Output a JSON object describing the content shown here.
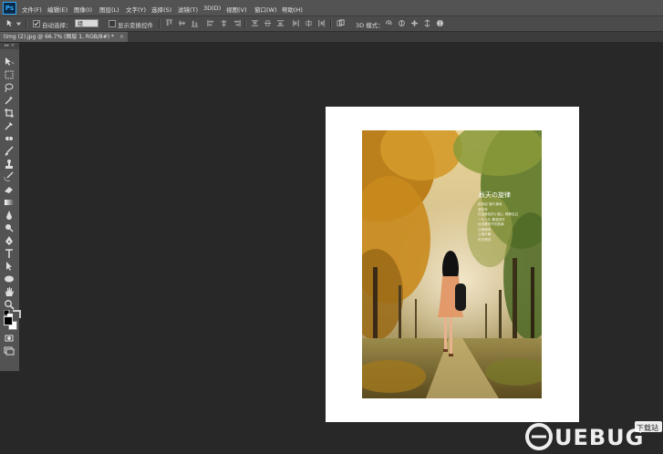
{
  "app": {
    "logo": "Ps"
  },
  "menu": [
    "文件(F)",
    "编辑(E)",
    "图像(I)",
    "图层(L)",
    "文字(Y)",
    "选择(S)",
    "滤镜(T)",
    "3D(D)",
    "视图(V)",
    "窗口(W)",
    "帮助(H)"
  ],
  "options": {
    "auto_select_label": "自动选择：",
    "auto_select_value": "组",
    "transform_label": "显示变换控件",
    "mode_3d_label": "3D 模式："
  },
  "document": {
    "tab_title": "timg (2).jpg @ 66.7% (图层 1, RGB/8#) *",
    "close": "×"
  },
  "toolbox": {
    "collapse": "▸▸ ×"
  },
  "artwork": {
    "title": "秋天の旋律",
    "poem_lines": [
      "秋风起 落叶满地",
      "漫步林",
      "在金黄色的小路上 静静走过",
      "一片一片 飘落的叶",
      "诉说着季节的故事",
      "往事随风",
      "心随叶舞",
      "时光清浅"
    ]
  },
  "watermark": {
    "text": "UEBUG",
    "sub": "下载站"
  },
  "colors": {
    "menubar": "#535353",
    "optbar": "#4b4b4b",
    "workspace": "#282828",
    "accent": "#31a8ff"
  }
}
